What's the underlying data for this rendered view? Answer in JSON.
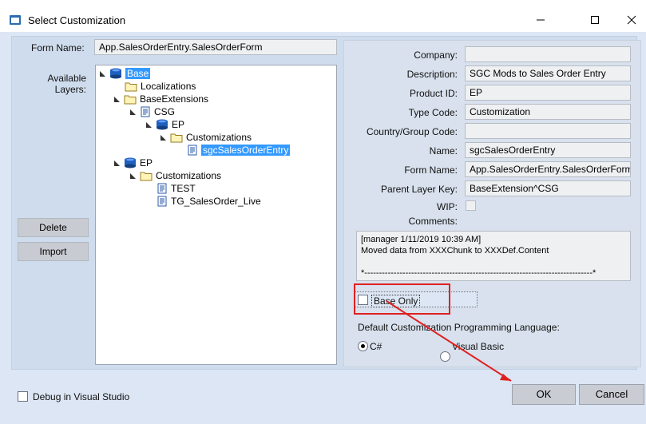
{
  "window": {
    "title": "Select Customization"
  },
  "left": {
    "form_name_label": "Form Name:",
    "form_name_value": "App.SalesOrderEntry.SalesOrderForm",
    "available_layers_label_1": "Available",
    "available_layers_label_2": "Layers:",
    "delete_label": "Delete",
    "import_label": "Import"
  },
  "tree": {
    "base": "Base",
    "localizations": "Localizations",
    "base_extensions": "BaseExtensions",
    "csg": "CSG",
    "ep": "EP",
    "customizations": "Customizations",
    "sgc_sales_order_entry": "sgcSalesOrderEntry",
    "ep2": "EP",
    "customizations2": "Customizations",
    "test": "TEST",
    "tg_salesorder_live": "TG_SalesOrder_Live"
  },
  "right": {
    "company_label": "Company:",
    "company_value": "",
    "description_label": "Description:",
    "description_value": "SGC Mods to Sales Order Entry",
    "product_id_label": "Product ID:",
    "product_id_value": "EP",
    "type_code_label": "Type Code:",
    "type_code_value": "Customization",
    "country_group_code_label": "Country/Group Code:",
    "country_group_code_value": "",
    "name_label": "Name:",
    "name_value": "sgcSalesOrderEntry",
    "form_name_label": "Form Name:",
    "form_name_value": "App.SalesOrderEntry.SalesOrderForm",
    "parent_layer_key_label": "Parent Layer Key:",
    "parent_layer_key_value": "BaseExtension^CSG",
    "wip_label": "WIP:",
    "comments_label": "Comments:",
    "comments_line1": "[manager 1/11/2019 10:39 AM]",
    "comments_line2": "Moved data from XXXChunk to XXXDef.Content",
    "comments_line3": "*------------------------------------------------------------------------------*",
    "base_only_label": "Base Only",
    "default_lang_label": "Default Customization Programming Language:",
    "radio_csharp": "C#",
    "radio_vb": "Visual Basic"
  },
  "bottom": {
    "debug_label": "Debug in Visual Studio",
    "ok_label": "OK",
    "cancel_label": "Cancel"
  },
  "colors": {
    "accent": "#3399ff",
    "annotation_red": "#e02020"
  }
}
